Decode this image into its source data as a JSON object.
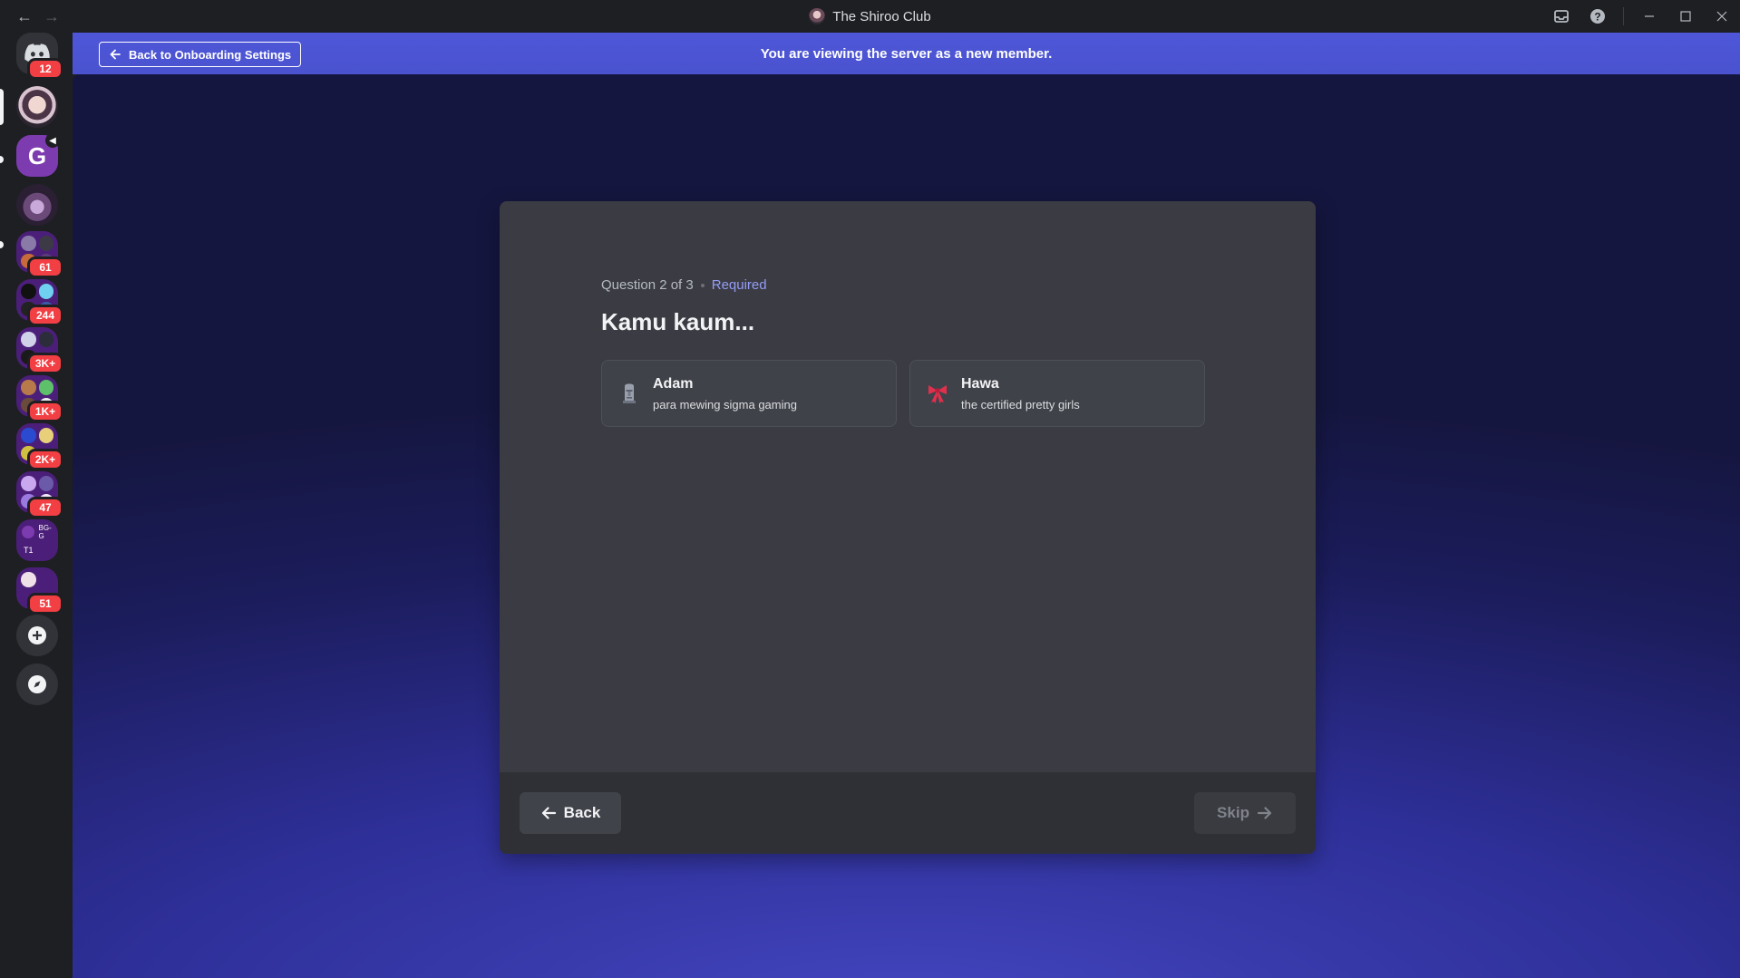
{
  "titlebar": {
    "title": "The Shiroo Club",
    "nav_back": "←",
    "nav_forward": "→",
    "icons": [
      "inbox-icon",
      "help-icon"
    ],
    "window_controls": [
      "minimize-icon",
      "maximize-icon",
      "close-icon"
    ]
  },
  "rail": {
    "home_badge": "12",
    "servers": [
      {
        "name": "The Shiroo Club",
        "badge": ""
      },
      {
        "name": "server-2",
        "badge": ""
      },
      {
        "name": "server-3",
        "badge": ""
      },
      {
        "name": "folder-1",
        "badge": "61"
      },
      {
        "name": "folder-2",
        "badge": "244"
      },
      {
        "name": "folder-3",
        "badge": "3K+"
      },
      {
        "name": "folder-4",
        "badge": "1K+"
      },
      {
        "name": "folder-5",
        "badge": "2K+"
      },
      {
        "name": "folder-6",
        "badge": "47"
      },
      {
        "name": "folder-7",
        "badge": ""
      },
      {
        "name": "folder-8",
        "badge": "51"
      }
    ],
    "folder7_labels": [
      "BG-G",
      "T1"
    ]
  },
  "banner": {
    "back_label": "Back to Onboarding Settings",
    "message": "You are viewing the server as a new member."
  },
  "question": {
    "count": "Question 2 of 3",
    "required": "Required",
    "title": "Kamu kaum...",
    "options": [
      {
        "name": "Adam",
        "desc": "para mewing sigma gaming",
        "icon": "moai-icon"
      },
      {
        "name": "Hawa",
        "desc": "the certified pretty girls",
        "icon": "ribbon-icon"
      }
    ]
  },
  "footer": {
    "back_label": "Back",
    "skip_label": "Skip"
  },
  "colors": {
    "accent": "#5865f2",
    "required": "#949cf7",
    "badge": "#f23f43"
  }
}
